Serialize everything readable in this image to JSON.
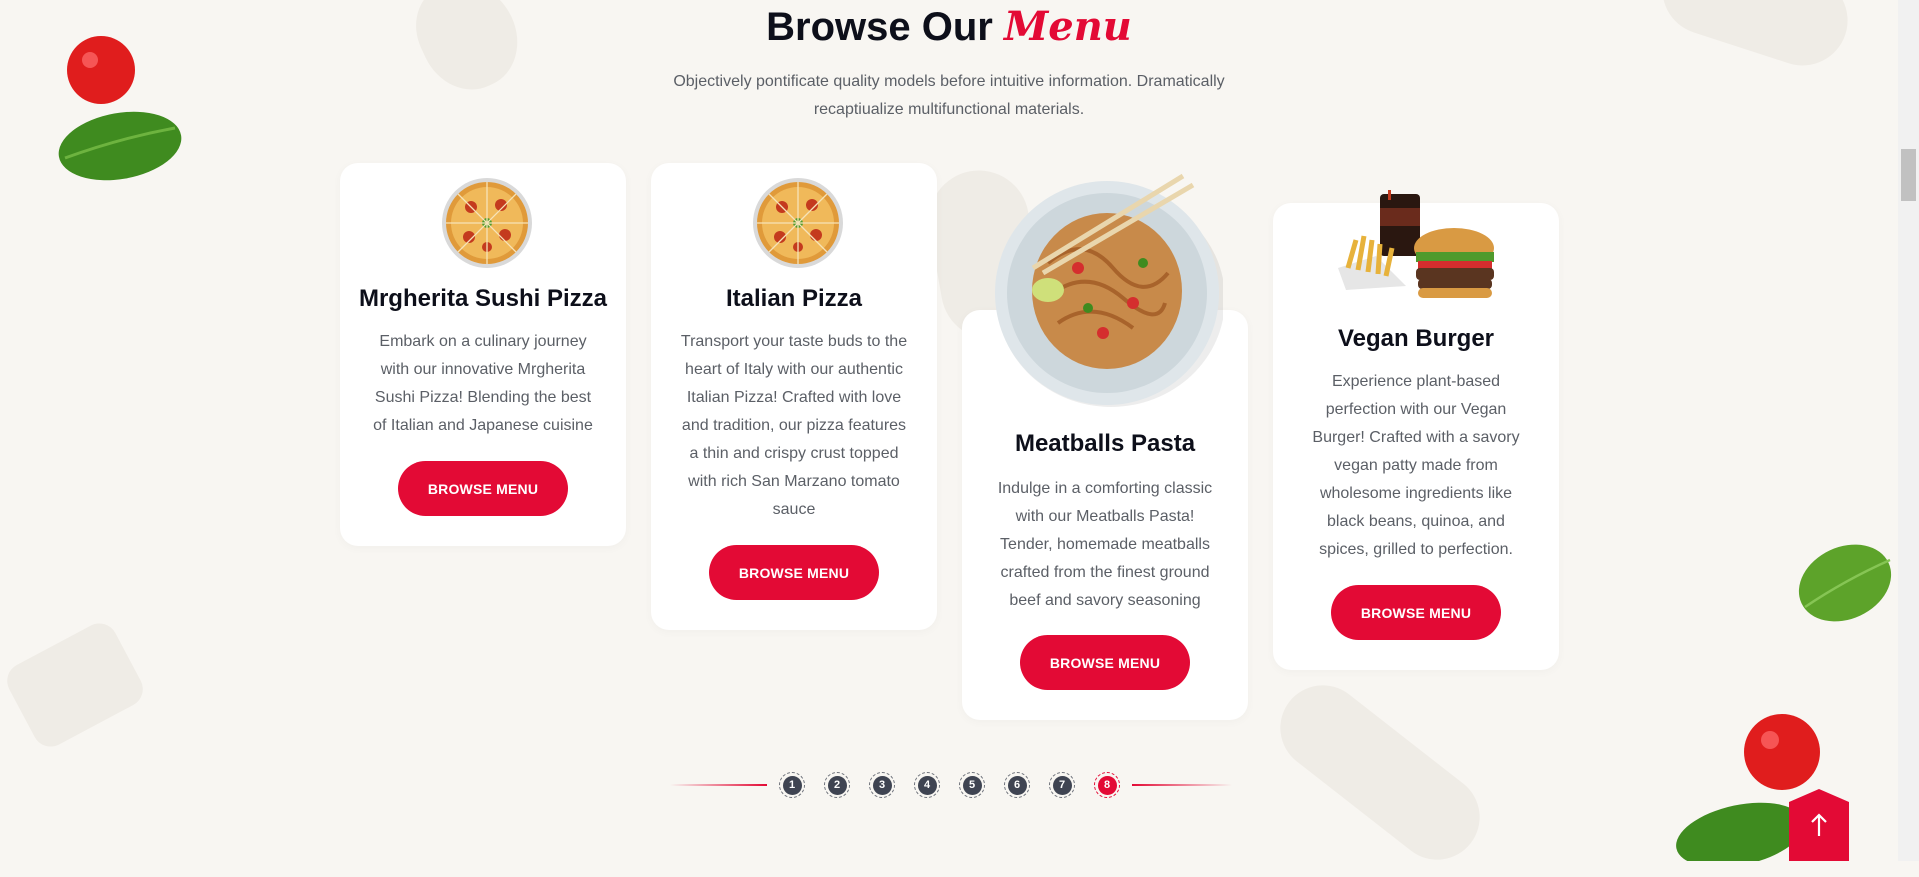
{
  "section": {
    "title_main": "Browse Our",
    "title_accent": "Menu",
    "subtitle": "Objectively pontificate quality models before intuitive information. Dramatically recaptiualize multifunctional materials."
  },
  "cards": [
    {
      "name": "Mrgherita Sushi Pizza",
      "description": "Embark on a culinary journey with our innovative Mrgherita Sushi Pizza! Blending the best of Italian and Japanese cuisine",
      "button": "BROWSE MENU",
      "image_icon": "pizza-icon"
    },
    {
      "name": "Italian Pizza",
      "description": "Transport your taste buds to the heart of Italy with our authentic Italian Pizza! Crafted with love and tradition, our pizza features a thin and crispy crust topped with rich San Marzano tomato sauce",
      "button": "BROWSE MENU",
      "image_icon": "pizza-icon"
    },
    {
      "name": "Meatballs Pasta",
      "description": "Indulge in a comforting classic with our Meatballs Pasta! Tender, homemade meatballs crafted from the finest ground beef and savory seasoning",
      "button": "BROWSE MENU",
      "image_icon": "noodle-bowl-icon"
    },
    {
      "name": "Vegan Burger",
      "description": "Experience plant-based perfection with our Vegan Burger! Crafted with a savory vegan patty made from wholesome ingredients like black beans, quinoa, and spices, grilled to perfection.",
      "button": "BROWSE MENU",
      "image_icon": "burger-combo-icon"
    }
  ],
  "pagination": {
    "pages": [
      "1",
      "2",
      "3",
      "4",
      "5",
      "6",
      "7",
      "8"
    ],
    "active": "8"
  },
  "colors": {
    "accent": "#e30a35",
    "background": "#f8f6f2",
    "card": "#ffffff",
    "heading": "#0d0f1a",
    "body_text": "#5b5f66",
    "dot": "#3f4452"
  },
  "icons": {
    "scroll_top": "arrow-up-icon",
    "decor": [
      "tomato-icon",
      "basil-leaf-icon"
    ]
  }
}
